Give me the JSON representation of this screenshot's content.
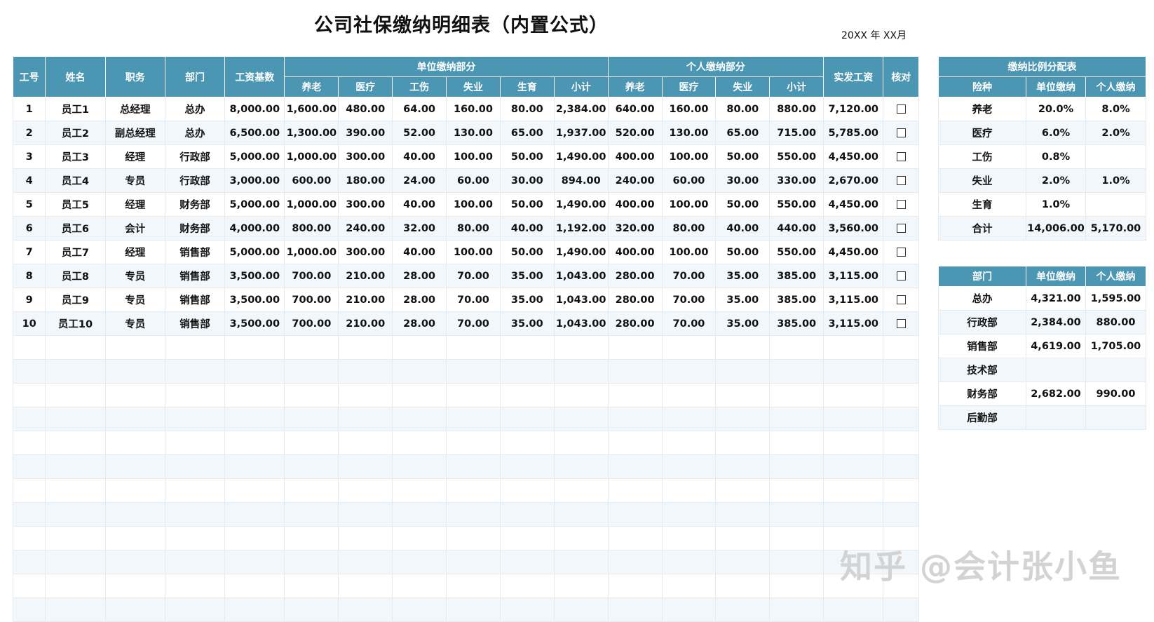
{
  "title": "公司社保缴纳明细表（内置公式）",
  "date_text": "20XX 年 XX月",
  "watermark": "知乎 @会计张小鱼",
  "main": {
    "headers": {
      "id": "工号",
      "name": "姓名",
      "position": "职务",
      "dept": "部门",
      "base": "工资基数",
      "employer_group": "单位缴纳部分",
      "employee_group": "个人缴纳部分",
      "net": "实发工资",
      "check": "核对"
    },
    "employer_sub": [
      "养老",
      "医疗",
      "工伤",
      "失业",
      "生育",
      "小计"
    ],
    "employee_sub": [
      "养老",
      "医疗",
      "失业",
      "小计"
    ],
    "rows": [
      [
        "1",
        "员工1",
        "总经理",
        "总办",
        "8,000.00",
        "1,600.00",
        "480.00",
        "64.00",
        "160.00",
        "80.00",
        "2,384.00",
        "640.00",
        "160.00",
        "80.00",
        "880.00",
        "7,120.00"
      ],
      [
        "2",
        "员工2",
        "副总经理",
        "总办",
        "6,500.00",
        "1,300.00",
        "390.00",
        "52.00",
        "130.00",
        "65.00",
        "1,937.00",
        "520.00",
        "130.00",
        "65.00",
        "715.00",
        "5,785.00"
      ],
      [
        "3",
        "员工3",
        "经理",
        "行政部",
        "5,000.00",
        "1,000.00",
        "300.00",
        "40.00",
        "100.00",
        "50.00",
        "1,490.00",
        "400.00",
        "100.00",
        "50.00",
        "550.00",
        "4,450.00"
      ],
      [
        "4",
        "员工4",
        "专员",
        "行政部",
        "3,000.00",
        "600.00",
        "180.00",
        "24.00",
        "60.00",
        "30.00",
        "894.00",
        "240.00",
        "60.00",
        "30.00",
        "330.00",
        "2,670.00"
      ],
      [
        "5",
        "员工5",
        "经理",
        "财务部",
        "5,000.00",
        "1,000.00",
        "300.00",
        "40.00",
        "100.00",
        "50.00",
        "1,490.00",
        "400.00",
        "100.00",
        "50.00",
        "550.00",
        "4,450.00"
      ],
      [
        "6",
        "员工6",
        "会计",
        "财务部",
        "4,000.00",
        "800.00",
        "240.00",
        "32.00",
        "80.00",
        "40.00",
        "1,192.00",
        "320.00",
        "80.00",
        "40.00",
        "440.00",
        "3,560.00"
      ],
      [
        "7",
        "员工7",
        "经理",
        "销售部",
        "5,000.00",
        "1,000.00",
        "300.00",
        "40.00",
        "100.00",
        "50.00",
        "1,490.00",
        "400.00",
        "100.00",
        "50.00",
        "550.00",
        "4,450.00"
      ],
      [
        "8",
        "员工8",
        "专员",
        "销售部",
        "3,500.00",
        "700.00",
        "210.00",
        "28.00",
        "70.00",
        "35.00",
        "1,043.00",
        "280.00",
        "70.00",
        "35.00",
        "385.00",
        "3,115.00"
      ],
      [
        "9",
        "员工9",
        "专员",
        "销售部",
        "3,500.00",
        "700.00",
        "210.00",
        "28.00",
        "70.00",
        "35.00",
        "1,043.00",
        "280.00",
        "70.00",
        "35.00",
        "385.00",
        "3,115.00"
      ],
      [
        "10",
        "员工10",
        "专员",
        "销售部",
        "3,500.00",
        "700.00",
        "210.00",
        "28.00",
        "70.00",
        "35.00",
        "1,043.00",
        "280.00",
        "70.00",
        "35.00",
        "385.00",
        "3,115.00"
      ]
    ],
    "empty_rows": 12
  },
  "ratio_table": {
    "title": "缴纳比例分配表",
    "headers": [
      "险种",
      "单位缴纳",
      "个人缴纳"
    ],
    "rows": [
      [
        "养老",
        "20.0%",
        "8.0%"
      ],
      [
        "医疗",
        "6.0%",
        "2.0%"
      ],
      [
        "工伤",
        "0.8%",
        ""
      ],
      [
        "失业",
        "2.0%",
        "1.0%"
      ],
      [
        "生育",
        "1.0%",
        ""
      ],
      [
        "合计",
        "14,006.00",
        "5,170.00"
      ]
    ]
  },
  "dept_table": {
    "headers": [
      "部门",
      "单位缴纳",
      "个人缴纳"
    ],
    "rows": [
      [
        "总办",
        "4,321.00",
        "1,595.00"
      ],
      [
        "行政部",
        "2,384.00",
        "880.00"
      ],
      [
        "销售部",
        "4,619.00",
        "1,705.00"
      ],
      [
        "技术部",
        "",
        ""
      ],
      [
        "财务部",
        "2,682.00",
        "990.00"
      ],
      [
        "后勤部",
        "",
        ""
      ]
    ]
  }
}
